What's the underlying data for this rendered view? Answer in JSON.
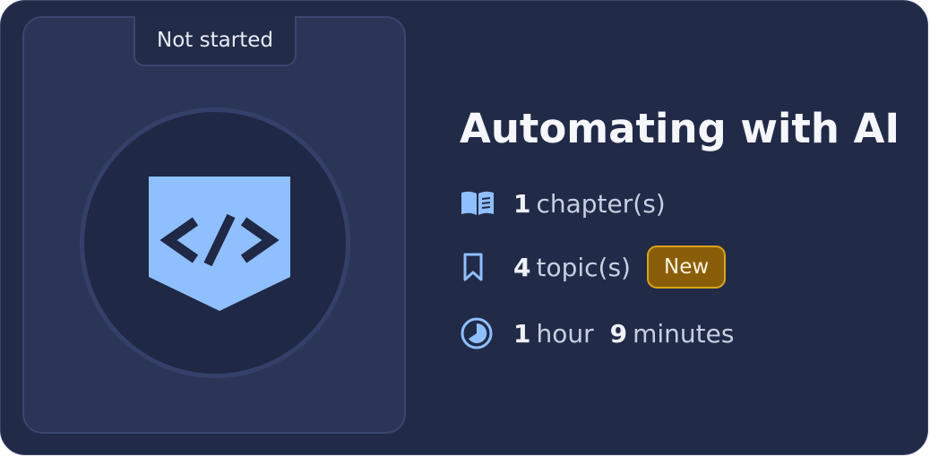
{
  "course": {
    "status": "Not started",
    "title": "Automating with AI",
    "chapters_count": "1",
    "chapters_label": "chapter(s)",
    "topics_count": "4",
    "topics_label": "topic(s)",
    "badge": "New",
    "hours_count": "1",
    "hours_label": "hour",
    "minutes_count": "9",
    "minutes_label": "minutes"
  },
  "icons": {
    "course": "code-shield-icon",
    "chapters": "book-open-icon",
    "topics": "bookmark-icon",
    "duration": "clock-icon"
  },
  "colors": {
    "card_background": "#212a47",
    "accent": "#8fbfff",
    "badge_background": "#8a5e08",
    "badge_border": "#d9a31c"
  }
}
